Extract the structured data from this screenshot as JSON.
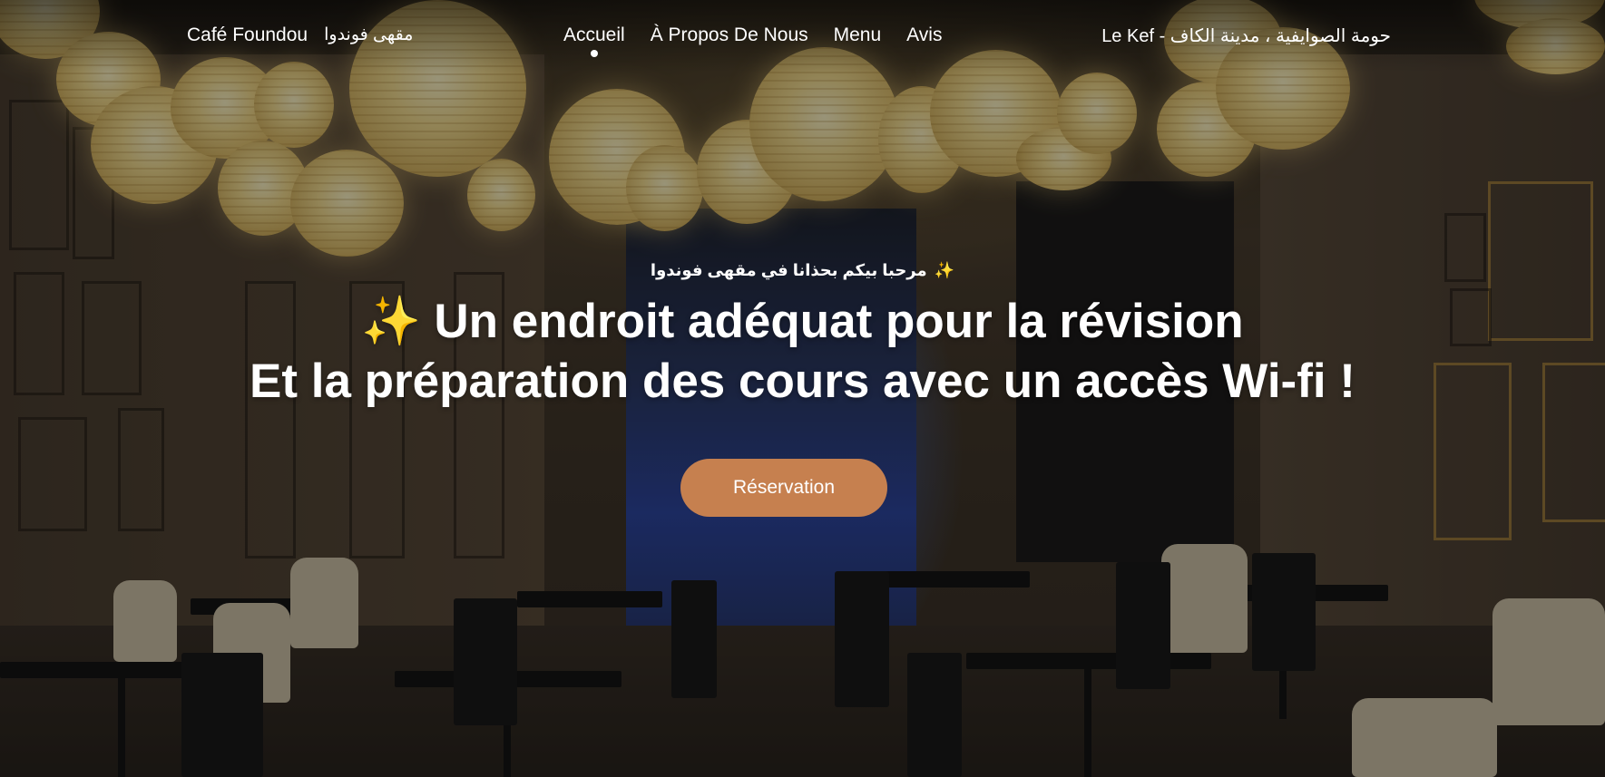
{
  "brand": {
    "name": "Café Foundou",
    "name_ar": "مقهى فوندوا"
  },
  "nav": {
    "items": [
      {
        "label": "Accueil",
        "active": true
      },
      {
        "label": "À Propos De Nous",
        "active": false
      },
      {
        "label": "Menu",
        "active": false
      },
      {
        "label": "Avis",
        "active": false
      }
    ]
  },
  "location": "Le Kef - حومة الصوايفية ، مدينة الكاف",
  "hero": {
    "welcome": "مرحبا بيكم بحذانا في مقهى فوندوا",
    "welcome_icon": "sparkles-icon",
    "headline_line1": "Un endroit adéquat pour la révision",
    "headline_line2": "Et la préparation des cours avec un accès Wi-fi !",
    "headline_icon": "sparkles-icon",
    "cta_label": "Réservation",
    "background": "cafe interior photo with paper lanterns"
  },
  "colors": {
    "accent": "#c6804f",
    "sparkle": "#f7c948",
    "text": "#ffffff"
  }
}
